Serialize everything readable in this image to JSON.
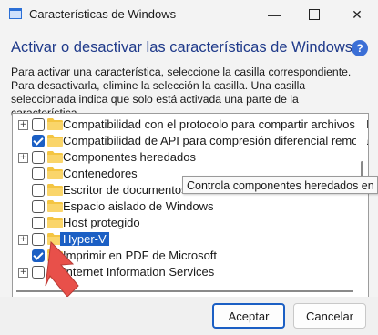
{
  "window": {
    "title": "Características de Windows",
    "minimize_glyph": "—",
    "close_glyph": "✕"
  },
  "heading": "Activar o desactivar las características de Windows",
  "help_glyph": "?",
  "description": "Para activar una característica, seleccione la casilla correspondiente. Para desactivarla, elimine la selección la casilla. Una casilla seleccionada indica que solo está activada una parte de la característica.",
  "tree": {
    "items": [
      {
        "label": "Compatibilidad con el protocolo para compartir archivos SMB",
        "checked": false,
        "expandable": true,
        "selected": false
      },
      {
        "label": "Compatibilidad de API para compresión diferencial remota",
        "checked": true,
        "expandable": false,
        "selected": false
      },
      {
        "label": "Componentes heredados",
        "checked": false,
        "expandable": true,
        "selected": false
      },
      {
        "label": "Contenedores",
        "checked": false,
        "expandable": false,
        "selected": false
      },
      {
        "label": "Escritor de documentos XPS de Microsoft",
        "checked": false,
        "expandable": false,
        "selected": false
      },
      {
        "label": "Espacio aislado de Windows",
        "checked": false,
        "expandable": false,
        "selected": false
      },
      {
        "label": "Host protegido",
        "checked": false,
        "expandable": false,
        "selected": false
      },
      {
        "label": "Hyper-V",
        "checked": false,
        "expandable": true,
        "selected": true
      },
      {
        "label": "Imprimir en PDF de Microsoft",
        "checked": true,
        "expandable": false,
        "selected": false
      },
      {
        "label": "Internet Information Services",
        "checked": false,
        "expandable": true,
        "selected": false
      }
    ],
    "expander_glyph": "+"
  },
  "tooltip": "Controla componentes heredados en Windows",
  "buttons": {
    "accept": "Aceptar",
    "cancel": "Cancelar"
  },
  "colors": {
    "accent": "#1b5fc4",
    "heading": "#1f3a8a",
    "folder": "#f4c542",
    "arrow": "#e8504a"
  }
}
